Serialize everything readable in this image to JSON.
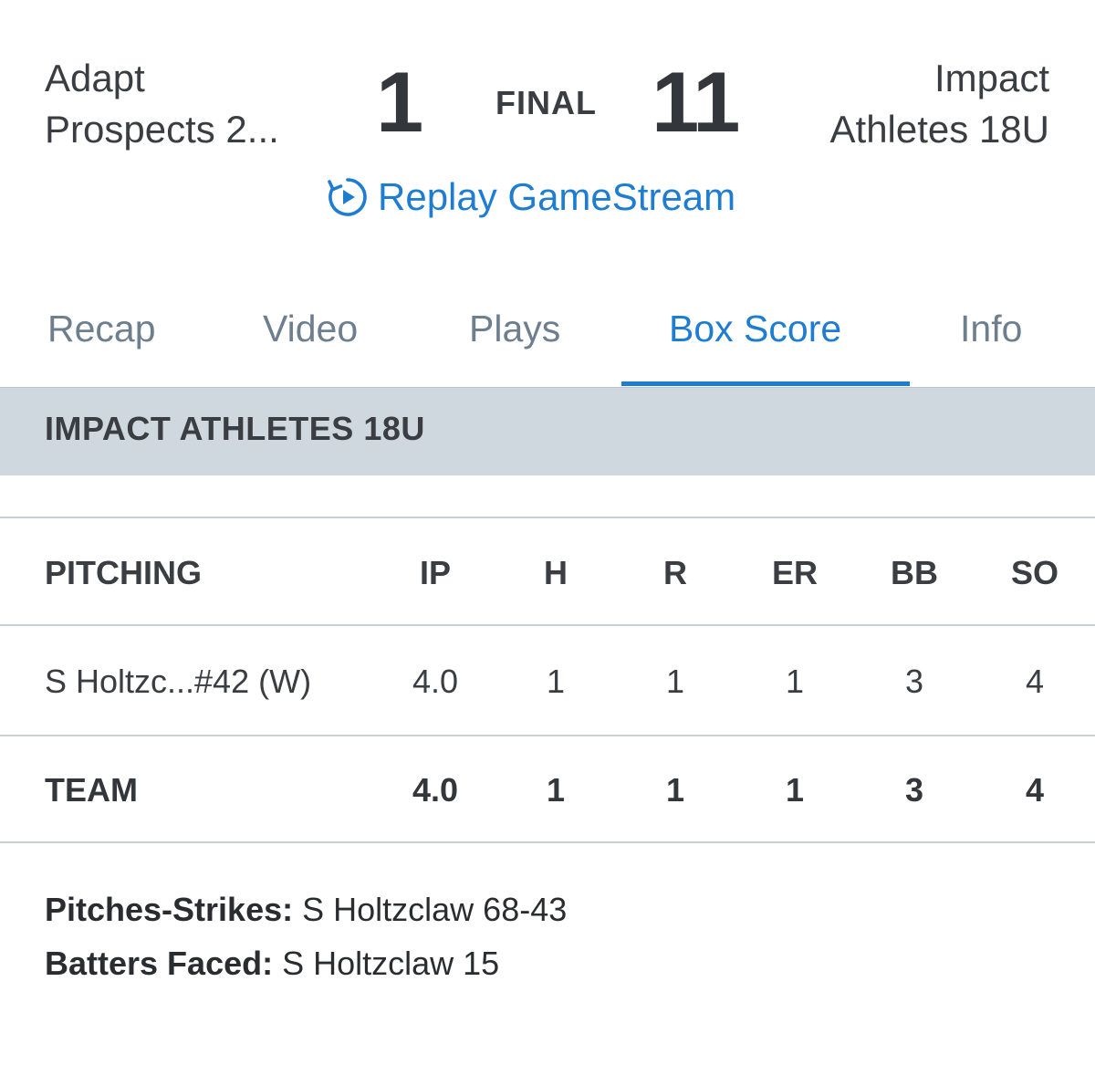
{
  "game": {
    "away_team": "Adapt Prospects 2...",
    "away_team_line1": "Adapt",
    "away_team_line2": "Prospects 2...",
    "away_score": "1",
    "status": "FINAL",
    "home_score": "11",
    "home_team_line1": "Impact",
    "home_team_line2": "Athletes 18U",
    "replay_label": "Replay GameStream"
  },
  "tabs": [
    {
      "label": "Recap",
      "active": false
    },
    {
      "label": "Video",
      "active": false
    },
    {
      "label": "Plays",
      "active": false
    },
    {
      "label": "Box Score",
      "active": true
    },
    {
      "label": "Info",
      "active": false
    }
  ],
  "team_section": {
    "title": "IMPACT ATHLETES 18U"
  },
  "pitching": {
    "headers": [
      "PITCHING",
      "IP",
      "H",
      "R",
      "ER",
      "BB",
      "SO"
    ],
    "rows": [
      [
        "S Holtzc...#42 (W)",
        "4.0",
        "1",
        "1",
        "1",
        "3",
        "4"
      ]
    ],
    "totals": [
      "TEAM",
      "4.0",
      "1",
      "1",
      "1",
      "3",
      "4"
    ]
  },
  "notes": [
    {
      "label": "Pitches-Strikes:",
      "value": "S Holtzclaw 68-43"
    },
    {
      "label": "Batters Faced:",
      "value": "S Holtzclaw 15"
    }
  ],
  "colors": {
    "accent": "#1f7dd1",
    "section_bar": "#cfd8de",
    "tab_inactive": "#6d7f8f"
  }
}
